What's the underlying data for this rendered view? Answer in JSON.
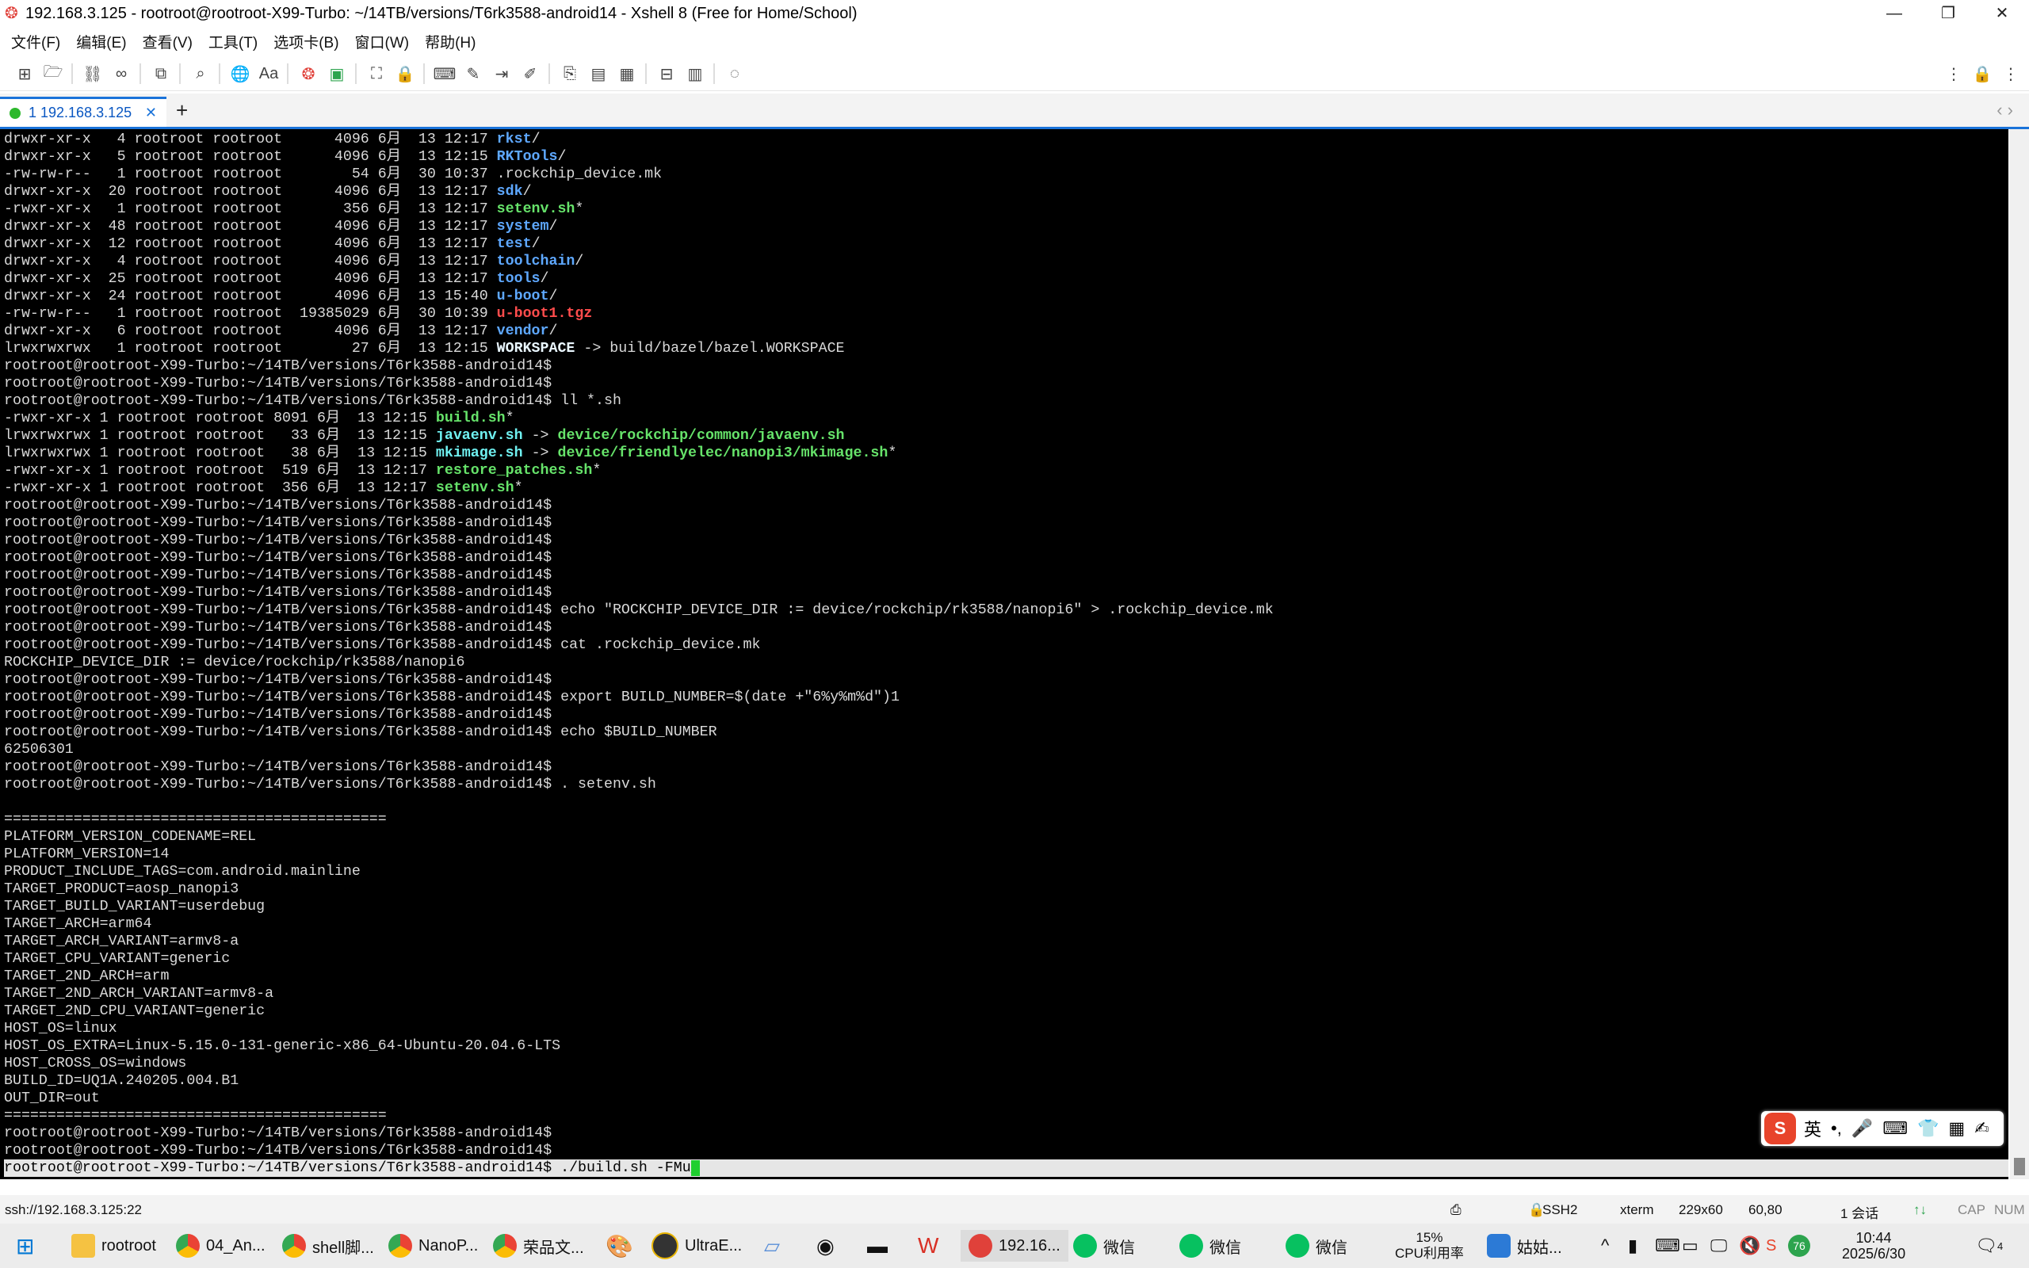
{
  "window": {
    "title": "192.168.3.125 - rootroot@rootroot-X99-Turbo: ~/14TB/versions/T6rk3588-android14 - Xshell 8 (Free for Home/School)",
    "minimize": "—",
    "restore": "❐",
    "close": "✕"
  },
  "menu": [
    "文件(F)",
    "编辑(E)",
    "查看(V)",
    "工具(T)",
    "选项卡(B)",
    "窗口(W)",
    "帮助(H)"
  ],
  "tab": {
    "label": "1 192.168.3.125",
    "close": "✕",
    "add": "+",
    "nav": "‹  ›"
  },
  "terminal": {
    "lines": [
      [
        [
          "drwxr-xr-x   4 rootroot rootroot      4096 6月  13 12:17 ",
          ""
        ],
        [
          "rkst",
          "dir"
        ],
        [
          "/",
          ""
        ]
      ],
      [
        [
          "drwxr-xr-x   5 rootroot rootroot      4096 6月  13 12:15 ",
          ""
        ],
        [
          "RKTools",
          "dir"
        ],
        [
          "/",
          ""
        ]
      ],
      [
        [
          "-rw-rw-r--   1 rootroot rootroot        54 6月  30 10:37 .rockchip_device.mk",
          ""
        ]
      ],
      [
        [
          "drwxr-xr-x  20 rootroot rootroot      4096 6月  13 12:17 ",
          ""
        ],
        [
          "sdk",
          "dir"
        ],
        [
          "/",
          ""
        ]
      ],
      [
        [
          "-rwxr-xr-x   1 rootroot rootroot       356 6月  13 12:17 ",
          ""
        ],
        [
          "setenv.sh",
          "exe"
        ],
        [
          "*",
          ""
        ]
      ],
      [
        [
          "drwxr-xr-x  48 rootroot rootroot      4096 6月  13 12:17 ",
          ""
        ],
        [
          "system",
          "dir"
        ],
        [
          "/",
          ""
        ]
      ],
      [
        [
          "drwxr-xr-x  12 rootroot rootroot      4096 6月  13 12:17 ",
          ""
        ],
        [
          "test",
          "dir"
        ],
        [
          "/",
          ""
        ]
      ],
      [
        [
          "drwxr-xr-x   4 rootroot rootroot      4096 6月  13 12:17 ",
          ""
        ],
        [
          "toolchain",
          "dir"
        ],
        [
          "/",
          ""
        ]
      ],
      [
        [
          "drwxr-xr-x  25 rootroot rootroot      4096 6月  13 12:17 ",
          ""
        ],
        [
          "tools",
          "dir"
        ],
        [
          "/",
          ""
        ]
      ],
      [
        [
          "drwxr-xr-x  24 rootroot rootroot      4096 6月  13 15:40 ",
          ""
        ],
        [
          "u-boot",
          "dir"
        ],
        [
          "/",
          ""
        ]
      ],
      [
        [
          "-rw-rw-r--   1 rootroot rootroot  19385029 6月  30 10:39 ",
          ""
        ],
        [
          "u-boot1.tgz",
          "arc"
        ]
      ],
      [
        [
          "drwxr-xr-x   6 rootroot rootroot      4096 6月  13 12:17 ",
          ""
        ],
        [
          "vendor",
          "dir"
        ],
        [
          "/",
          ""
        ]
      ],
      [
        [
          "lrwxrwxrwx   1 rootroot rootroot        27 6月  13 12:15 ",
          ""
        ],
        [
          "WORKSPACE",
          "wsp"
        ],
        [
          " -> build/bazel/bazel.WORKSPACE",
          ""
        ]
      ],
      [
        [
          "rootroot@rootroot-X99-Turbo:~/14TB/versions/T6rk3588-android14$",
          ""
        ]
      ],
      [
        [
          "rootroot@rootroot-X99-Turbo:~/14TB/versions/T6rk3588-android14$",
          ""
        ]
      ],
      [
        [
          "rootroot@rootroot-X99-Turbo:~/14TB/versions/T6rk3588-android14$ ll *.sh",
          ""
        ]
      ],
      [
        [
          "-rwxr-xr-x 1 rootroot rootroot 8091 6月  13 12:15 ",
          ""
        ],
        [
          "build.sh",
          "exe"
        ],
        [
          "*",
          ""
        ]
      ],
      [
        [
          "lrwxrwxrwx 1 rootroot rootroot   33 6月  13 12:15 ",
          ""
        ],
        [
          "javaenv.sh",
          "lnk"
        ],
        [
          " -> ",
          ""
        ],
        [
          "device/rockchip/common/javaenv.sh",
          "exe"
        ]
      ],
      [
        [
          "lrwxrwxrwx 1 rootroot rootroot   38 6月  13 12:15 ",
          ""
        ],
        [
          "mkimage.sh",
          "lnk"
        ],
        [
          " -> ",
          ""
        ],
        [
          "device/friendlyelec/nanopi3/mkimage.sh",
          "exe"
        ],
        [
          "*",
          ""
        ]
      ],
      [
        [
          "-rwxr-xr-x 1 rootroot rootroot  519 6月  13 12:17 ",
          ""
        ],
        [
          "restore_patches.sh",
          "exe"
        ],
        [
          "*",
          ""
        ]
      ],
      [
        [
          "-rwxr-xr-x 1 rootroot rootroot  356 6月  13 12:17 ",
          ""
        ],
        [
          "setenv.sh",
          "exe"
        ],
        [
          "*",
          ""
        ]
      ],
      [
        [
          "rootroot@rootroot-X99-Turbo:~/14TB/versions/T6rk3588-android14$",
          ""
        ]
      ],
      [
        [
          "rootroot@rootroot-X99-Turbo:~/14TB/versions/T6rk3588-android14$",
          ""
        ]
      ],
      [
        [
          "rootroot@rootroot-X99-Turbo:~/14TB/versions/T6rk3588-android14$",
          ""
        ]
      ],
      [
        [
          "rootroot@rootroot-X99-Turbo:~/14TB/versions/T6rk3588-android14$",
          ""
        ]
      ],
      [
        [
          "rootroot@rootroot-X99-Turbo:~/14TB/versions/T6rk3588-android14$",
          ""
        ]
      ],
      [
        [
          "rootroot@rootroot-X99-Turbo:~/14TB/versions/T6rk3588-android14$",
          ""
        ]
      ],
      [
        [
          "rootroot@rootroot-X99-Turbo:~/14TB/versions/T6rk3588-android14$ echo \"ROCKCHIP_DEVICE_DIR := device/rockchip/rk3588/nanopi6\" > .rockchip_device.mk",
          ""
        ]
      ],
      [
        [
          "rootroot@rootroot-X99-Turbo:~/14TB/versions/T6rk3588-android14$",
          ""
        ]
      ],
      [
        [
          "rootroot@rootroot-X99-Turbo:~/14TB/versions/T6rk3588-android14$ cat .rockchip_device.mk",
          ""
        ]
      ],
      [
        [
          "ROCKCHIP_DEVICE_DIR := device/rockchip/rk3588/nanopi6",
          ""
        ]
      ],
      [
        [
          "rootroot@rootroot-X99-Turbo:~/14TB/versions/T6rk3588-android14$",
          ""
        ]
      ],
      [
        [
          "rootroot@rootroot-X99-Turbo:~/14TB/versions/T6rk3588-android14$ export BUILD_NUMBER=$(date +\"6%y%m%d\")1",
          ""
        ]
      ],
      [
        [
          "rootroot@rootroot-X99-Turbo:~/14TB/versions/T6rk3588-android14$",
          ""
        ]
      ],
      [
        [
          "rootroot@rootroot-X99-Turbo:~/14TB/versions/T6rk3588-android14$ echo $BUILD_NUMBER",
          ""
        ]
      ],
      [
        [
          "62506301",
          ""
        ]
      ],
      [
        [
          "rootroot@rootroot-X99-Turbo:~/14TB/versions/T6rk3588-android14$",
          ""
        ]
      ],
      [
        [
          "rootroot@rootroot-X99-Turbo:~/14TB/versions/T6rk3588-android14$ . setenv.sh",
          ""
        ]
      ],
      [
        [
          "",
          ""
        ]
      ],
      [
        [
          "============================================",
          ""
        ]
      ],
      [
        [
          "PLATFORM_VERSION_CODENAME=REL",
          ""
        ]
      ],
      [
        [
          "PLATFORM_VERSION=14",
          ""
        ]
      ],
      [
        [
          "PRODUCT_INCLUDE_TAGS=com.android.mainline",
          ""
        ]
      ],
      [
        [
          "TARGET_PRODUCT=aosp_nanopi3",
          ""
        ]
      ],
      [
        [
          "TARGET_BUILD_VARIANT=userdebug",
          ""
        ]
      ],
      [
        [
          "TARGET_ARCH=arm64",
          ""
        ]
      ],
      [
        [
          "TARGET_ARCH_VARIANT=armv8-a",
          ""
        ]
      ],
      [
        [
          "TARGET_CPU_VARIANT=generic",
          ""
        ]
      ],
      [
        [
          "TARGET_2ND_ARCH=arm",
          ""
        ]
      ],
      [
        [
          "TARGET_2ND_ARCH_VARIANT=armv8-a",
          ""
        ]
      ],
      [
        [
          "TARGET_2ND_CPU_VARIANT=generic",
          ""
        ]
      ],
      [
        [
          "HOST_OS=linux",
          ""
        ]
      ],
      [
        [
          "HOST_OS_EXTRA=Linux-5.15.0-131-generic-x86_64-Ubuntu-20.04.6-LTS",
          ""
        ]
      ],
      [
        [
          "HOST_CROSS_OS=windows",
          ""
        ]
      ],
      [
        [
          "BUILD_ID=UQ1A.240205.004.B1",
          ""
        ]
      ],
      [
        [
          "OUT_DIR=out",
          ""
        ]
      ],
      [
        [
          "============================================",
          ""
        ]
      ],
      [
        [
          "rootroot@rootroot-X99-Turbo:~/14TB/versions/T6rk3588-android14$",
          ""
        ]
      ],
      [
        [
          "rootroot@rootroot-X99-Turbo:~/14TB/versions/T6rk3588-android14$",
          ""
        ]
      ]
    ],
    "current_line": "rootroot@rootroot-X99-Turbo:~/14TB/versions/T6rk3588-android14$ ./build.sh -FMu",
    "cursor": "_"
  },
  "ime": {
    "logo": "S",
    "items": [
      "英",
      "•,",
      "🎤",
      "⌨",
      "👕",
      "▦",
      "✍"
    ]
  },
  "status": {
    "connection": "ssh://192.168.3.125:22",
    "protocol": "SSH2",
    "term": "xterm",
    "size": "229x60",
    "pos": "60,80",
    "sessions": "1 会话",
    "caps": "CAP",
    "num": "NUM"
  },
  "taskbar": {
    "items": [
      "rootroot",
      "04_An...",
      "shell脚...",
      "NanoP...",
      "荣品文...",
      "UltraE...",
      "192.16...",
      "微信",
      "微信",
      "微信",
      "姑姑..."
    ],
    "cpu_pct": "15%",
    "cpu_label": "CPU利用率",
    "time": "10:44",
    "date": "2025/6/30",
    "badge": "76",
    "notif": "4"
  }
}
